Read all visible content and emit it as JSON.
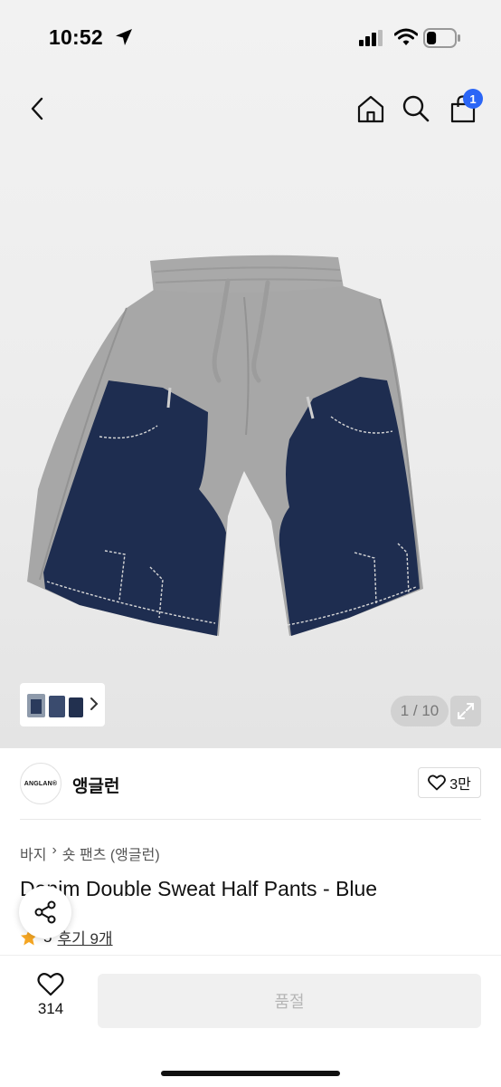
{
  "status": {
    "time": "10:52",
    "battery_level": 0.35
  },
  "nav": {
    "cart_count": "1"
  },
  "gallery": {
    "counter": "1 / 10",
    "current_image": 1,
    "total_images": 10
  },
  "brand": {
    "logo_text": "ANGLAN®",
    "name": "앵글런",
    "like_count": "3만"
  },
  "breadcrumb": [
    "바지",
    "숏 팬츠 (앵글런)"
  ],
  "product": {
    "title": "Denim Double Sweat Half Pants - Blue",
    "rating": "5",
    "reviews_label": "후기 9개"
  },
  "bottom": {
    "like_count": "314",
    "cta_label": "품절"
  },
  "colors": {
    "accent": "#2b66f6",
    "rating_star": "#f5a623",
    "denim": "#1e2d50",
    "sweat_gray": "#a7a7a7"
  }
}
